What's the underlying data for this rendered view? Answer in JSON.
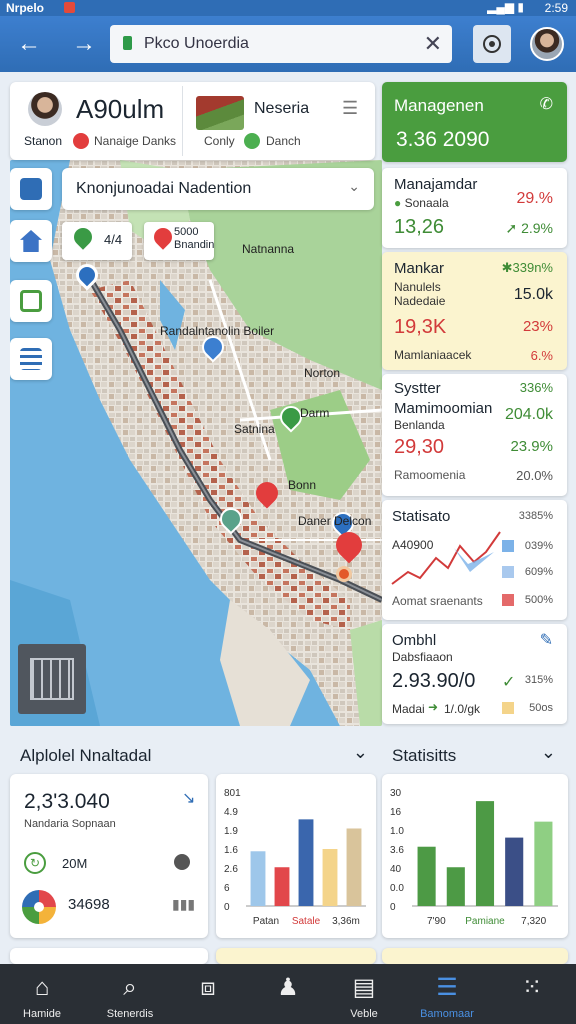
{
  "status_bar": {
    "app": "Nrpelo",
    "time": "2:59"
  },
  "browser": {
    "url": "Pkco Unoerdia"
  },
  "location_card": {
    "title": "A90ulm",
    "status_label": "Stanon",
    "status_text": "Nanaige Danks",
    "place": "Neseria",
    "sub_label": "Conly",
    "sub_text": "Danch"
  },
  "map": {
    "search_text": "Knonjunoadai Nadention",
    "pin_labels": [
      "4/4",
      "5000 Bnandin"
    ],
    "labels": [
      "Natnanna",
      "Randalntanolin Boiler",
      "Norton",
      "Satnina",
      "Darm",
      "Bonn",
      "Daner Delcon"
    ]
  },
  "panel": {
    "header_title": "Managenen",
    "header_value": "3.36 2090",
    "cards": [
      {
        "title": "Manajamdar",
        "sub": "Sonaala",
        "pct1": "29.%",
        "value": "13,26",
        "pct2": "2.9%"
      },
      {
        "title": "Mankar",
        "sub": "Nanulels Nadedaie",
        "pct1": "339n%",
        "value2": "15.0k",
        "value": "19,3K",
        "pct2": "23%",
        "foot": "Mamlaniaacek",
        "pct3": "6.%"
      },
      {
        "title": "Systter",
        "title2": "Mamimoomian",
        "sub": "Benlanda",
        "pct1": "336%",
        "value2": "204.0k",
        "value": "29,30",
        "pct2": "23.9%",
        "foot": "Ramoomenia",
        "pct3": "20.0%"
      },
      {
        "title": "Statisato",
        "pct1": "3385%",
        "value": "A40900",
        "legend1": "039%",
        "legend2": "609%",
        "foot": "Aomat sraenants",
        "legend3": "500%"
      },
      {
        "title": "Ombhl",
        "sub": "Dabsfiaaon",
        "value": "2.93.90/0",
        "pct1": "315%",
        "foot": "Madai",
        "arrow_text": "1/.0/gk",
        "pct2": "50os"
      }
    ]
  },
  "sections": {
    "left_title": "Alplolel Nnaltadal",
    "right_title": "Statisitts"
  },
  "summary_card": {
    "value": "2,3'3.040",
    "sub": "Nandaria Sopnaan",
    "row1": "20M",
    "row2": "34698"
  },
  "chart_data": [
    {
      "type": "bar",
      "categories": [
        "Patan",
        "Satale",
        "3,36m"
      ],
      "yticks": [
        "801",
        "4.9",
        "1.9",
        "1.6",
        "2.6",
        "6",
        "0"
      ],
      "ylim": [
        0,
        5
      ],
      "values": [
        2.4,
        1.7,
        3.8,
        2.5,
        3.4
      ],
      "colors": [
        "#9ec7ea",
        "#e2474b",
        "#3a66ad",
        "#f4d48a",
        "#d9c49b"
      ]
    },
    {
      "type": "bar",
      "categories": [
        "7'90",
        "Pamiane",
        "7,320"
      ],
      "yticks": [
        "30",
        "16",
        "1.0",
        "3.6",
        "40",
        "0.0",
        "0"
      ],
      "ylim": [
        0,
        5
      ],
      "values": [
        2.6,
        1.7,
        4.6,
        3.0,
        3.7
      ],
      "colors": [
        "#4d9a45",
        "#4d9a45",
        "#4d9a45",
        "#3b4f87",
        "#8fcf83"
      ]
    }
  ],
  "tabbar": {
    "tabs": [
      {
        "label": "Hamide",
        "icon": "home-icon"
      },
      {
        "label": "Stenerdis",
        "icon": "search-icon"
      },
      {
        "label": "",
        "icon": "cube-icon"
      },
      {
        "label": "",
        "icon": "person-icon"
      },
      {
        "label": "Veble",
        "icon": "inbox-icon"
      },
      {
        "label": "Bamomaar",
        "icon": "document-icon"
      },
      {
        "label": "",
        "icon": "grid-icon"
      }
    ]
  },
  "colors": {
    "brand": "#2f6db5",
    "accent_green": "#4a9d3f",
    "danger": "#e23d3d",
    "tabbar": "#2a2f35"
  }
}
